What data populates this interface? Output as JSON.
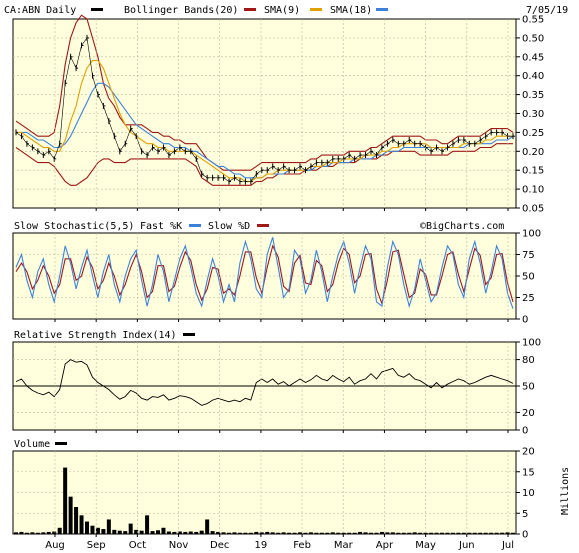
{
  "header": {
    "symbol_label": "CA:ABN Daily",
    "bollinger_label": "Bollinger Bands(20)",
    "sma9_label": "SMA(9)",
    "sma18_label": "SMA(18)",
    "date": "7/05/19"
  },
  "stoch_panel": {
    "label": "Slow Stochastic(5,5)",
    "fast_label": "Fast %K",
    "slow_label": "Slow %D",
    "watermark": "©BigCharts.com"
  },
  "rsi_panel": {
    "label": "Relative Strength Index(14)"
  },
  "volume_panel": {
    "label": "Volume",
    "unit_label": "Millions"
  },
  "colors": {
    "background": "#ffffdd",
    "price": "#000000",
    "bollinger": "#a01818",
    "sma9": "#e0a000",
    "sma18": "#3c82dc",
    "fast_k": "#3c82dc",
    "slow_d": "#a01818",
    "rsi": "#000000",
    "volume": "#000000"
  },
  "chart_data": [
    {
      "type": "line",
      "title": "CA:ABN Daily",
      "series": [
        {
          "name": "CA:ABN Daily",
          "values": [
            0.25,
            0.24,
            0.22,
            0.21,
            0.2,
            0.19,
            0.2,
            0.18,
            0.22,
            0.38,
            0.45,
            0.42,
            0.48,
            0.5,
            0.4,
            0.35,
            0.32,
            0.28,
            0.24,
            0.2,
            0.22,
            0.26,
            0.24,
            0.2,
            0.19,
            0.21,
            0.2,
            0.21,
            0.19,
            0.2,
            0.21,
            0.2,
            0.2,
            0.18,
            0.14,
            0.13,
            0.13,
            0.13,
            0.13,
            0.12,
            0.13,
            0.12,
            0.12,
            0.12,
            0.14,
            0.15,
            0.15,
            0.16,
            0.15,
            0.16,
            0.15,
            0.15,
            0.16,
            0.15,
            0.16,
            0.17,
            0.17,
            0.17,
            0.18,
            0.18,
            0.18,
            0.19,
            0.18,
            0.19,
            0.19,
            0.2,
            0.19,
            0.21,
            0.22,
            0.23,
            0.22,
            0.22,
            0.23,
            0.22,
            0.22,
            0.21,
            0.2,
            0.21,
            0.2,
            0.21,
            0.22,
            0.23,
            0.23,
            0.22,
            0.22,
            0.23,
            0.24,
            0.25,
            0.25,
            0.25,
            0.24,
            0.24
          ]
        },
        {
          "name": "Bollinger Bands(20) upper",
          "values": [
            0.28,
            0.27,
            0.26,
            0.25,
            0.24,
            0.24,
            0.24,
            0.25,
            0.32,
            0.43,
            0.5,
            0.54,
            0.56,
            0.55,
            0.5,
            0.45,
            0.38,
            0.34,
            0.32,
            0.29,
            0.27,
            0.27,
            0.27,
            0.27,
            0.26,
            0.25,
            0.25,
            0.24,
            0.24,
            0.23,
            0.23,
            0.22,
            0.22,
            0.22,
            0.2,
            0.18,
            0.17,
            0.16,
            0.15,
            0.15,
            0.15,
            0.15,
            0.15,
            0.15,
            0.16,
            0.17,
            0.17,
            0.17,
            0.17,
            0.17,
            0.17,
            0.17,
            0.17,
            0.17,
            0.18,
            0.18,
            0.19,
            0.19,
            0.19,
            0.19,
            0.19,
            0.2,
            0.2,
            0.2,
            0.2,
            0.21,
            0.21,
            0.22,
            0.23,
            0.24,
            0.24,
            0.24,
            0.24,
            0.24,
            0.24,
            0.23,
            0.23,
            0.23,
            0.22,
            0.22,
            0.23,
            0.24,
            0.24,
            0.24,
            0.24,
            0.24,
            0.25,
            0.26,
            0.26,
            0.26,
            0.26,
            0.25
          ]
        },
        {
          "name": "Bollinger Bands(20) lower",
          "values": [
            0.21,
            0.2,
            0.19,
            0.18,
            0.17,
            0.17,
            0.17,
            0.16,
            0.14,
            0.12,
            0.11,
            0.11,
            0.12,
            0.13,
            0.15,
            0.17,
            0.18,
            0.18,
            0.17,
            0.17,
            0.17,
            0.18,
            0.18,
            0.18,
            0.18,
            0.18,
            0.18,
            0.18,
            0.18,
            0.18,
            0.18,
            0.18,
            0.17,
            0.16,
            0.13,
            0.12,
            0.11,
            0.11,
            0.11,
            0.11,
            0.11,
            0.11,
            0.11,
            0.11,
            0.12,
            0.12,
            0.13,
            0.13,
            0.14,
            0.14,
            0.14,
            0.14,
            0.14,
            0.15,
            0.15,
            0.15,
            0.16,
            0.16,
            0.16,
            0.17,
            0.17,
            0.17,
            0.17,
            0.18,
            0.18,
            0.18,
            0.18,
            0.19,
            0.19,
            0.2,
            0.2,
            0.2,
            0.2,
            0.2,
            0.19,
            0.19,
            0.19,
            0.19,
            0.19,
            0.19,
            0.2,
            0.2,
            0.2,
            0.2,
            0.2,
            0.21,
            0.21,
            0.21,
            0.22,
            0.22,
            0.22,
            0.22
          ]
        },
        {
          "name": "SMA(9)",
          "values": [
            0.25,
            0.25,
            0.24,
            0.23,
            0.22,
            0.21,
            0.21,
            0.2,
            0.2,
            0.23,
            0.28,
            0.32,
            0.38,
            0.42,
            0.44,
            0.44,
            0.42,
            0.38,
            0.34,
            0.3,
            0.27,
            0.25,
            0.24,
            0.23,
            0.22,
            0.22,
            0.21,
            0.21,
            0.2,
            0.2,
            0.2,
            0.2,
            0.2,
            0.19,
            0.18,
            0.17,
            0.16,
            0.15,
            0.14,
            0.13,
            0.13,
            0.13,
            0.12,
            0.12,
            0.13,
            0.13,
            0.14,
            0.14,
            0.15,
            0.15,
            0.15,
            0.15,
            0.15,
            0.15,
            0.16,
            0.16,
            0.16,
            0.17,
            0.17,
            0.17,
            0.18,
            0.18,
            0.18,
            0.18,
            0.19,
            0.19,
            0.19,
            0.2,
            0.2,
            0.21,
            0.21,
            0.22,
            0.22,
            0.22,
            0.22,
            0.22,
            0.21,
            0.21,
            0.21,
            0.21,
            0.21,
            0.21,
            0.22,
            0.22,
            0.22,
            0.22,
            0.23,
            0.23,
            0.24,
            0.24,
            0.24,
            0.24
          ]
        },
        {
          "name": "SMA(18)",
          "values": [
            0.25,
            0.25,
            0.25,
            0.24,
            0.23,
            0.23,
            0.22,
            0.21,
            0.21,
            0.22,
            0.24,
            0.27,
            0.3,
            0.33,
            0.36,
            0.38,
            0.38,
            0.37,
            0.35,
            0.33,
            0.31,
            0.29,
            0.27,
            0.26,
            0.25,
            0.24,
            0.23,
            0.22,
            0.22,
            0.21,
            0.21,
            0.21,
            0.2,
            0.2,
            0.19,
            0.18,
            0.17,
            0.16,
            0.16,
            0.15,
            0.14,
            0.14,
            0.13,
            0.13,
            0.13,
            0.13,
            0.14,
            0.14,
            0.14,
            0.14,
            0.15,
            0.15,
            0.15,
            0.15,
            0.15,
            0.16,
            0.16,
            0.16,
            0.17,
            0.17,
            0.17,
            0.17,
            0.18,
            0.18,
            0.18,
            0.18,
            0.19,
            0.19,
            0.2,
            0.2,
            0.2,
            0.21,
            0.21,
            0.21,
            0.21,
            0.21,
            0.21,
            0.21,
            0.21,
            0.21,
            0.21,
            0.21,
            0.21,
            0.22,
            0.22,
            0.22,
            0.22,
            0.22,
            0.23,
            0.23,
            0.23,
            0.24
          ]
        }
      ],
      "y_ticks": [
        "0.55",
        "0.50",
        "0.45",
        "0.40",
        "0.35",
        "0.30",
        "0.25",
        "0.20",
        "0.15",
        "0.10",
        "0.05"
      ],
      "ylim": [
        0.05,
        0.55
      ]
    },
    {
      "type": "line",
      "title": "Slow Stochastic(5,5)",
      "series": [
        {
          "name": "Fast %K",
          "values": [
            60,
            75,
            45,
            25,
            55,
            70,
            40,
            20,
            50,
            85,
            65,
            35,
            60,
            80,
            50,
            25,
            55,
            75,
            40,
            20,
            50,
            70,
            80,
            45,
            15,
            40,
            75,
            55,
            20,
            45,
            70,
            85,
            60,
            30,
            15,
            45,
            70,
            50,
            20,
            40,
            20,
            65,
            90,
            70,
            35,
            25,
            75,
            95,
            60,
            25,
            35,
            80,
            70,
            30,
            45,
            80,
            55,
            20,
            50,
            75,
            90,
            65,
            30,
            60,
            85,
            70,
            20,
            15,
            60,
            90,
            75,
            40,
            15,
            35,
            70,
            45,
            20,
            30,
            60,
            85,
            75,
            40,
            25,
            70,
            90,
            65,
            30,
            55,
            85,
            70,
            30,
            12
          ]
        },
        {
          "name": "Slow %D",
          "values": [
            55,
            65,
            55,
            35,
            45,
            62,
            50,
            30,
            40,
            70,
            70,
            45,
            50,
            72,
            60,
            35,
            45,
            65,
            50,
            28,
            40,
            60,
            75,
            55,
            25,
            32,
            62,
            62,
            32,
            38,
            60,
            78,
            68,
            40,
            22,
            35,
            60,
            58,
            30,
            35,
            28,
            50,
            78,
            78,
            48,
            30,
            60,
            85,
            72,
            38,
            32,
            65,
            74,
            42,
            40,
            68,
            62,
            32,
            40,
            65,
            82,
            75,
            42,
            50,
            75,
            76,
            35,
            18,
            45,
            78,
            80,
            52,
            25,
            30,
            58,
            52,
            28,
            28,
            50,
            75,
            78,
            52,
            32,
            58,
            82,
            74,
            40,
            48,
            75,
            76,
            42,
            20
          ]
        }
      ],
      "y_ticks": [
        "100",
        "75",
        "50",
        "25",
        "0"
      ],
      "ylim": [
        0,
        100
      ]
    },
    {
      "type": "line",
      "title": "Relative Strength Index(14)",
      "series": [
        {
          "name": "Relative Strength Index(14)",
          "values": [
            55,
            58,
            50,
            45,
            42,
            40,
            43,
            38,
            46,
            75,
            80,
            77,
            78,
            74,
            60,
            54,
            50,
            46,
            40,
            35,
            38,
            45,
            42,
            36,
            34,
            38,
            37,
            40,
            34,
            36,
            39,
            38,
            36,
            32,
            28,
            30,
            34,
            36,
            34,
            32,
            34,
            32,
            36,
            34,
            54,
            58,
            54,
            58,
            52,
            55,
            50,
            54,
            58,
            54,
            57,
            62,
            58,
            56,
            62,
            58,
            55,
            60,
            52,
            56,
            58,
            64,
            58,
            66,
            68,
            70,
            62,
            60,
            64,
            58,
            56,
            52,
            48,
            54,
            48,
            52,
            55,
            58,
            56,
            52,
            54,
            57,
            60,
            62,
            60,
            58,
            56,
            53
          ]
        }
      ],
      "y_ticks": [
        "100",
        "80",
        "50",
        "20",
        "0"
      ],
      "ylim": [
        0,
        100
      ]
    },
    {
      "type": "bar",
      "title": "Volume",
      "series": [
        {
          "name": "Volume",
          "values": [
            0.4,
            0.5,
            0.3,
            0.4,
            0.3,
            0.4,
            0.5,
            0.6,
            1.5,
            16.0,
            9.0,
            6.5,
            4.5,
            3.0,
            2.0,
            1.5,
            1.2,
            3.5,
            1.0,
            0.8,
            0.7,
            2.5,
            1.0,
            0.8,
            4.5,
            0.7,
            0.9,
            1.5,
            0.6,
            0.5,
            0.6,
            0.5,
            0.6,
            0.5,
            0.8,
            3.5,
            0.7,
            0.5,
            0.4,
            0.3,
            0.4,
            0.3,
            0.3,
            0.3,
            0.5,
            0.4,
            0.5,
            0.4,
            0.3,
            0.4,
            0.3,
            0.3,
            0.4,
            0.3,
            0.4,
            0.3,
            0.3,
            0.3,
            0.4,
            0.3,
            0.3,
            0.3,
            0.3,
            0.5,
            0.4,
            0.3,
            0.3,
            0.5,
            0.4,
            0.4,
            0.3,
            0.3,
            0.3,
            0.4,
            0.3,
            0.3,
            0.3,
            0.3,
            0.3,
            0.3,
            0.3,
            0.3,
            0.3,
            0.3,
            0.3,
            0.3,
            0.3,
            0.3,
            0.3,
            0.3,
            0.4,
            0.3
          ]
        }
      ],
      "y_ticks": [
        "20",
        "15",
        "10",
        "5",
        "0"
      ],
      "ylim": [
        0,
        20
      ],
      "ylabel": "Millions"
    }
  ],
  "x_axis": {
    "labels": [
      "Aug",
      "Sep",
      "Oct",
      "Nov",
      "Dec",
      "19",
      "Feb",
      "Mar",
      "Apr",
      "May",
      "Jun",
      "Jul"
    ]
  }
}
